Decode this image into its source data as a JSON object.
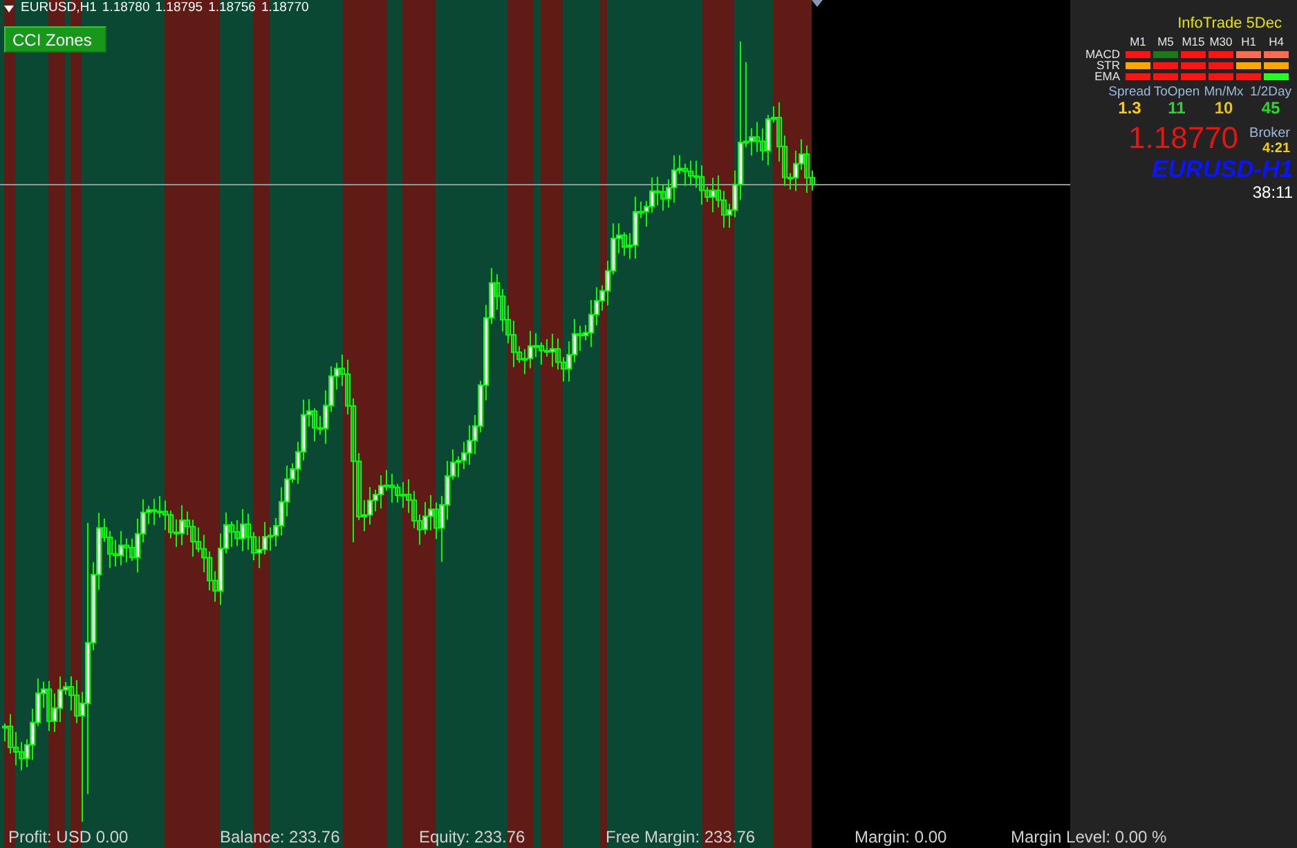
{
  "chart_header": {
    "symbol": "EURUSD,H1",
    "prices": [
      "1.18780",
      "1.18795",
      "1.18756",
      "1.18770"
    ]
  },
  "indicator_button": {
    "label": "CCI Zones"
  },
  "info_panel": {
    "title": "InfoTrade 5Dec",
    "timeframes": [
      "M1",
      "M5",
      "M15",
      "M30",
      "H1",
      "H4"
    ],
    "signal_rows": [
      {
        "label": "MACD",
        "cells": [
          {
            "color": "#ff1414"
          },
          {
            "color": "#1a7a1a"
          },
          {
            "color": "#ff1414"
          },
          {
            "color": "#ff1414"
          },
          {
            "color": "#ff6a50"
          },
          {
            "color": "#ff6a50"
          }
        ]
      },
      {
        "label": "STR",
        "cells": [
          {
            "color": "#ffa500"
          },
          {
            "color": "#ff1414"
          },
          {
            "color": "#ff1414"
          },
          {
            "color": "#ff1414"
          },
          {
            "color": "#ffa500"
          },
          {
            "color": "#ffa500"
          }
        ]
      },
      {
        "label": "EMA",
        "cells": [
          {
            "color": "#ff1414"
          },
          {
            "color": "#ff1414"
          },
          {
            "color": "#ff1414"
          },
          {
            "color": "#ff1414"
          },
          {
            "color": "#ff1414"
          },
          {
            "color": "#22ff22"
          }
        ]
      }
    ],
    "stats": [
      {
        "label": "Spread",
        "value": "1.3",
        "color": "#ffcc00"
      },
      {
        "label": "ToOpen",
        "value": "11",
        "color": "#22dd22"
      },
      {
        "label": "Mn/Mx",
        "value": "10",
        "color": "#e8c400"
      },
      {
        "label": "1/2Day",
        "value": "45",
        "color": "#22dd22"
      }
    ],
    "price": "1.18770",
    "broker": {
      "label": "Broker",
      "time": "4:21"
    },
    "symbol": "EURUSD-H1",
    "countdown": "38:11"
  },
  "account_bar": [
    "Profit: USD 0.00",
    "Balance: 233.76",
    "Equity: 233.76",
    "Free Margin: 233.76",
    "Margin: 0.00",
    "Margin Level: 0.00 %"
  ]
}
